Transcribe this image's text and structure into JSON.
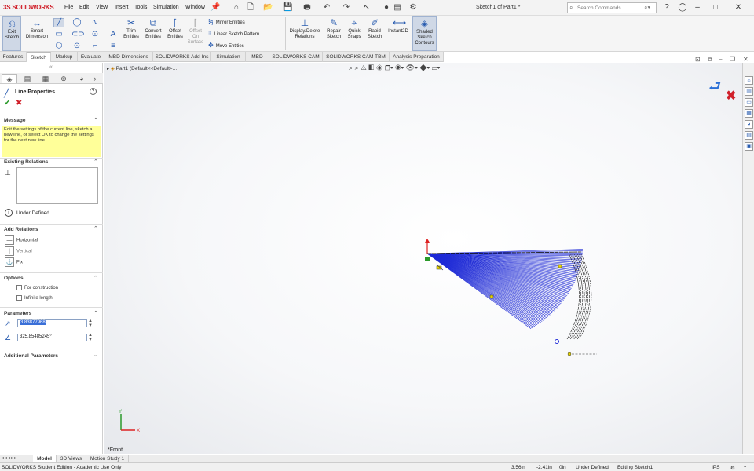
{
  "app": {
    "logo": "SOLIDWORKS",
    "menus": [
      "File",
      "Edit",
      "View",
      "Insert",
      "Tools",
      "Simulation",
      "Window"
    ],
    "document_title": "Sketch1 of Part1 *",
    "search_placeholder": "Search Commands"
  },
  "command_manager": {
    "exit_sketch": "Exit\nSketch",
    "smart_dimension": "Smart\nDimension",
    "trim_entities": "Trim\nEntities",
    "convert_entities": "Convert\nEntities",
    "offset_entities": "Offset\nEntities",
    "offset_on_surface": "Offset\nOn\nSurface",
    "mirror_entities": "Mirror Entities",
    "linear_sketch_pattern": "Linear Sketch Pattern",
    "move_entities": "Move Entities",
    "display_delete_relations": "Display/Delete\nRelations",
    "repair_sketch": "Repair\nSketch",
    "quick_snaps": "Quick\nSnaps",
    "rapid_sketch": "Rapid\nSketch",
    "instant2d": "Instant2D",
    "shaded_sketch_contours": "Shaded\nSketch\nContours"
  },
  "tabs": [
    "Features",
    "Sketch",
    "Markup",
    "Evaluate",
    "MBD Dimensions",
    "SOLIDWORKS Add-Ins",
    "Simulation",
    "MBD",
    "SOLIDWORKS CAM",
    "SOLIDWORKS CAM TBM",
    "Analysis Preparation"
  ],
  "active_tab": "Sketch",
  "property_manager": {
    "title": "Line Properties",
    "message_header": "Message",
    "message": "Edit the settings of the current line, sketch a new line, or select OK to change the settings for the next new line.",
    "existing_relations_header": "Existing Relations",
    "status": "Under Defined",
    "add_relations_header": "Add Relations",
    "relations": [
      "Horizontal",
      "Vertical",
      "Fix"
    ],
    "options_header": "Options",
    "options": [
      "For construction",
      "Infinite length"
    ],
    "parameters_header": "Parameters",
    "length_value": "3.83877968",
    "angle_value": "325.85485245°",
    "additional_parameters_header": "Additional Parameters"
  },
  "graphics": {
    "tree_root": "Part1 (Default<<Default>...",
    "view_label": "*Front"
  },
  "bottom_tabs": [
    "Model",
    "3D Views",
    "Motion Study 1"
  ],
  "status_bar": {
    "edition": "SOLIDWORKS Student Edition - Academic Use Only",
    "x": "3.56in",
    "y": "-2.41in",
    "z": "0in",
    "state": "Under Defined",
    "editing": "Editing Sketch1",
    "units": "IPS"
  },
  "colors": {
    "sketch_lines": "#1f2bd6",
    "brand_red": "#d0202a",
    "message_bg": "#ffff99"
  }
}
